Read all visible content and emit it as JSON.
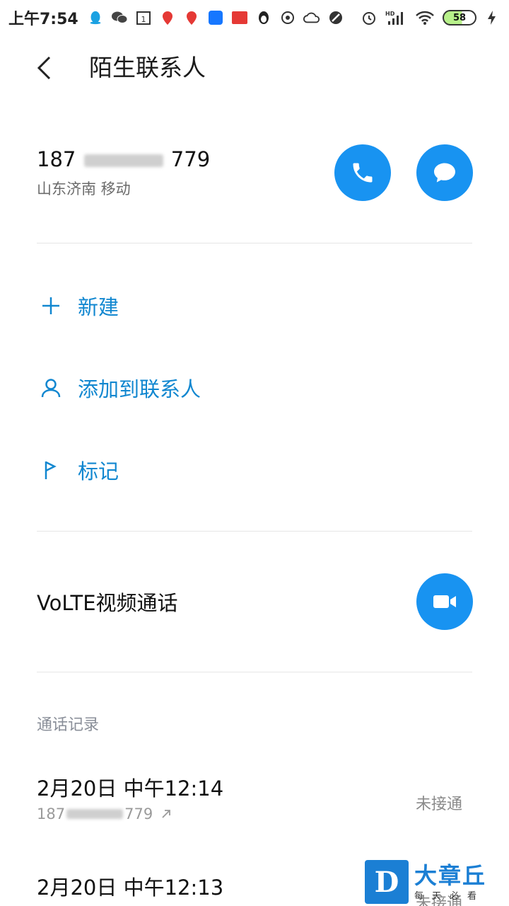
{
  "status_bar": {
    "time": "上午7:54",
    "battery": "58",
    "network": "HD"
  },
  "header": {
    "title": "陌生联系人"
  },
  "caller": {
    "number_prefix": "187",
    "number_suffix": "779",
    "location": "山东济南 移动"
  },
  "actions": [
    {
      "label": "新建",
      "icon": "plus-icon"
    },
    {
      "label": "添加到联系人",
      "icon": "person-icon"
    },
    {
      "label": "标记",
      "icon": "flag-icon"
    }
  ],
  "volte": {
    "label": "VoLTE视频通话"
  },
  "call_log": {
    "title": "通话记录",
    "entries": [
      {
        "time": "2月20日 中午12:14",
        "number_prefix": "187",
        "number_suffix": "779",
        "status": "未接通"
      },
      {
        "time": "2月20日 中午12:13",
        "number_prefix": "",
        "number_suffix": "",
        "status": "未接通"
      }
    ]
  },
  "watermark": {
    "badge": "D",
    "name": "大章丘",
    "slogan": "每天必看"
  },
  "colors": {
    "accent": "#1893f1",
    "action_text": "#1187d0"
  }
}
